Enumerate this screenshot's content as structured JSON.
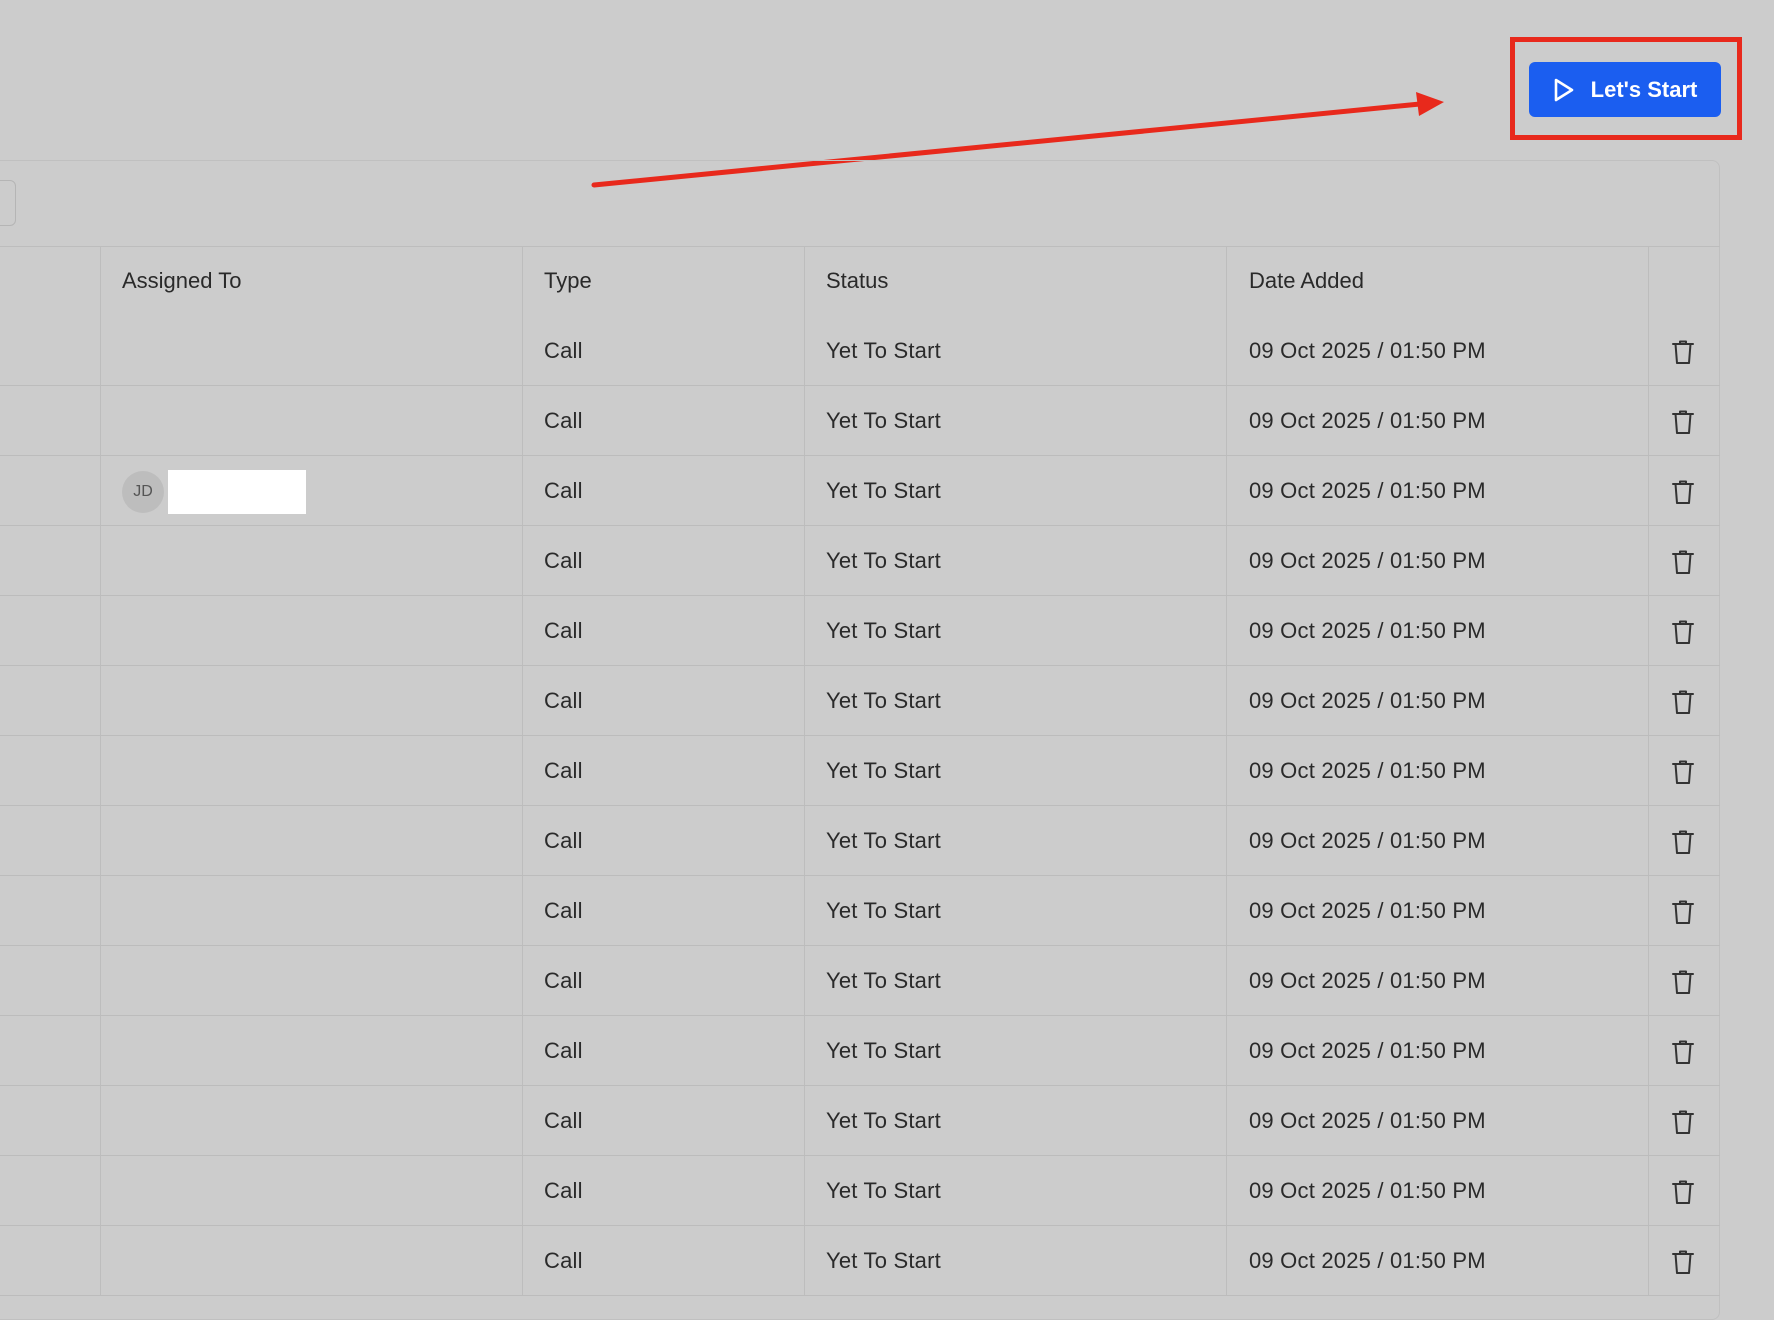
{
  "toolbar": {
    "start_label": "Let's Start",
    "start_icon": "play-icon",
    "button_color": "#1b5ef0",
    "highlight_color": "#e8291c"
  },
  "table": {
    "headers": {
      "assigned_to": "Assigned To",
      "type": "Type",
      "status": "Status",
      "date_added": "Date Added"
    },
    "rows": [
      {
        "assignee_initials": "",
        "type": "Call",
        "status": "Yet To Start",
        "date_added": "09 Oct 2025 / 01:50 PM",
        "action_icon": "trash-icon"
      },
      {
        "assignee_initials": "",
        "type": "Call",
        "status": "Yet To Start",
        "date_added": "09 Oct 2025 / 01:50 PM",
        "action_icon": "trash-icon"
      },
      {
        "assignee_initials": "JD",
        "type": "Call",
        "status": "Yet To Start",
        "date_added": "09 Oct 2025 / 01:50 PM",
        "action_icon": "trash-icon"
      },
      {
        "assignee_initials": "",
        "type": "Call",
        "status": "Yet To Start",
        "date_added": "09 Oct 2025 / 01:50 PM",
        "action_icon": "trash-icon"
      },
      {
        "assignee_initials": "",
        "type": "Call",
        "status": "Yet To Start",
        "date_added": "09 Oct 2025 / 01:50 PM",
        "action_icon": "trash-icon"
      },
      {
        "assignee_initials": "",
        "type": "Call",
        "status": "Yet To Start",
        "date_added": "09 Oct 2025 / 01:50 PM",
        "action_icon": "trash-icon"
      },
      {
        "assignee_initials": "",
        "type": "Call",
        "status": "Yet To Start",
        "date_added": "09 Oct 2025 / 01:50 PM",
        "action_icon": "trash-icon"
      },
      {
        "assignee_initials": "",
        "type": "Call",
        "status": "Yet To Start",
        "date_added": "09 Oct 2025 / 01:50 PM",
        "action_icon": "trash-icon"
      },
      {
        "assignee_initials": "",
        "type": "Call",
        "status": "Yet To Start",
        "date_added": "09 Oct 2025 / 01:50 PM",
        "action_icon": "trash-icon"
      },
      {
        "assignee_initials": "",
        "type": "Call",
        "status": "Yet To Start",
        "date_added": "09 Oct 2025 / 01:50 PM",
        "action_icon": "trash-icon"
      },
      {
        "assignee_initials": "",
        "type": "Call",
        "status": "Yet To Start",
        "date_added": "09 Oct 2025 / 01:50 PM",
        "action_icon": "trash-icon"
      },
      {
        "assignee_initials": "",
        "type": "Call",
        "status": "Yet To Start",
        "date_added": "09 Oct 2025 / 01:50 PM",
        "action_icon": "trash-icon"
      },
      {
        "assignee_initials": "",
        "type": "Call",
        "status": "Yet To Start",
        "date_added": "09 Oct 2025 / 01:50 PM",
        "action_icon": "trash-icon"
      },
      {
        "assignee_initials": "",
        "type": "Call",
        "status": "Yet To Start",
        "date_added": "09 Oct 2025 / 01:50 PM",
        "action_icon": "trash-icon"
      }
    ]
  }
}
